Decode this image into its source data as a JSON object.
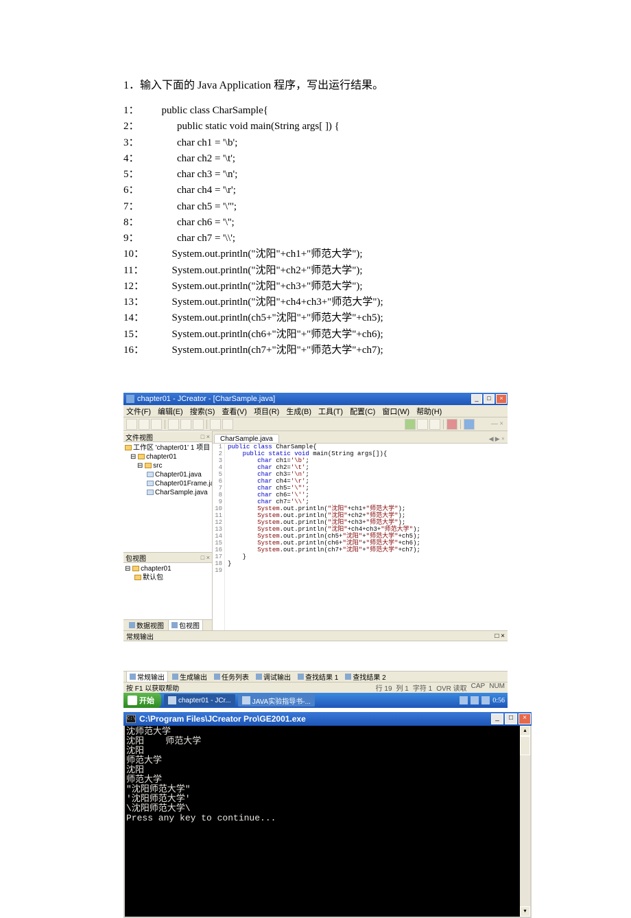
{
  "heading": "1．输入下面的 Java Application 程序，写出运行结果。",
  "lines": [
    {
      "n": "1：",
      "t": "  public class CharSample{"
    },
    {
      "n": "2：",
      "t": "        public static void main(String args[ ]) {"
    },
    {
      "n": "3：",
      "t": "        char ch1 = '\\b';"
    },
    {
      "n": "4：",
      "t": "        char ch2 = '\\t';"
    },
    {
      "n": "5：",
      "t": "        char ch3 = '\\n';"
    },
    {
      "n": "6：",
      "t": "        char ch4 = '\\r';"
    },
    {
      "n": "7：",
      "t": "        char ch5 = '\\\"';"
    },
    {
      "n": "8：",
      "t": "        char ch6 = '\\'';"
    },
    {
      "n": "9：",
      "t": "        char ch7 = '\\\\';"
    },
    {
      "n": "10：",
      "t": "      System.out.println(\"沈阳\"+ch1+\"师范大学\");"
    },
    {
      "n": "11：",
      "t": "      System.out.println(\"沈阳\"+ch2+\"师范大学\");"
    },
    {
      "n": "12：",
      "t": "      System.out.println(\"沈阳\"+ch3+\"师范大学\");"
    },
    {
      "n": "13：",
      "t": "      System.out.println(\"沈阳\"+ch4+ch3+\"师范大学\");"
    },
    {
      "n": "14：",
      "t": "      System.out.println(ch5+\"沈阳\"+\"师范大学\"+ch5);"
    },
    {
      "n": "15：",
      "t": "      System.out.println(ch6+\"沈阳\"+\"师范大学\"+ch6);"
    },
    {
      "n": "16：",
      "t": "      System.out.println(ch7+\"沈阳\"+\"师范大学\"+ch7);"
    }
  ],
  "ide": {
    "title": "chapter01 - JCreator - [CharSample.java]",
    "menus": [
      "文件(F)",
      "编辑(E)",
      "搜索(S)",
      "查看(V)",
      "项目(R)",
      "生成(B)",
      "工具(T)",
      "配置(C)",
      "窗口(W)",
      "帮助(H)"
    ],
    "filePanel": "文件视图",
    "workspace": "工作区 'chapter01' 1 项目",
    "project": "chapter01",
    "srcFolder": "src",
    "files": [
      "Chapter01.java",
      "Chapter01Frame.java",
      "CharSample.java"
    ],
    "pkgPanel": "包视图",
    "pkgProject": "chapter01",
    "pkgDefault": "默认包",
    "editorTab": "CharSample.java",
    "bottomTabsLeft": [
      "数据视图",
      "包视图"
    ],
    "outputHead": "常规输出",
    "outputTabs": [
      "常规输出",
      "生成输出",
      "任务列表",
      "调试输出",
      "查找结果 1",
      "查找结果 2"
    ],
    "status": "按 F1 以获取帮助",
    "statusRight": [
      "行 19",
      "列 1",
      "字符 1",
      "OVR 读取",
      "CAP",
      "NUM"
    ],
    "start": "开始",
    "task1": "chapter01 - JCr...",
    "task2": "JAVA实验指导书-...",
    "tray": "0:56",
    "panelCtrl": "□ ×",
    "editorTabCtrl": "◀ ▶ ×"
  },
  "console": {
    "title": "C:\\Program Files\\JCreator Pro\\GE2001.exe",
    "out": [
      "沈师范大学",
      "沈阳    师范大学",
      "沈阳",
      "师范大学",
      "沈阳",
      "师范大学",
      "\"沈阳师范大学\"",
      "'沈阳师范大学'",
      "\\沈阳师范大学\\",
      "Press any key to continue..."
    ]
  }
}
